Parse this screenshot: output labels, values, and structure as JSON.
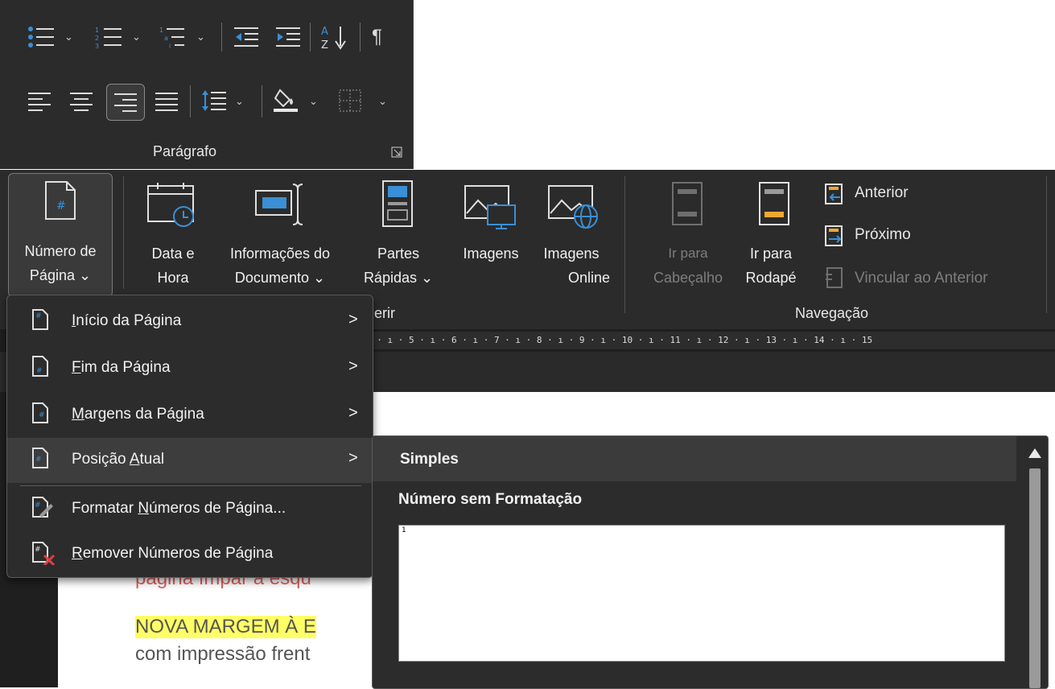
{
  "paragraph_group": {
    "label": "Parágrafo",
    "icons_row1": [
      "bullets-icon",
      "numbering-icon",
      "multilevel-list-icon",
      "decrease-indent-icon",
      "increase-indent-icon",
      "sort-icon",
      "pilcrow-icon"
    ],
    "icons_row2": [
      "align-left-icon",
      "align-center-icon",
      "align-right-icon",
      "justify-icon",
      "line-spacing-icon",
      "shading-icon",
      "borders-icon"
    ]
  },
  "ribbon": {
    "page_number": {
      "line1": "Número de",
      "line2": "Página ⌄"
    },
    "date_time": {
      "line1": "Data e",
      "line2": "Hora"
    },
    "doc_info": {
      "line1": "Informações do",
      "line2": "Documento ⌄"
    },
    "quick_parts": {
      "line1": "Partes",
      "line2": "Rápidas ⌄"
    },
    "images": {
      "line1": "Imagens",
      "line2": ""
    },
    "online_images": {
      "line1": "Imagens",
      "line2": "Online"
    },
    "group_insert_partial": "erir",
    "go_to_header": {
      "line1": "Ir para",
      "line2": "Cabeçalho"
    },
    "go_to_footer": {
      "line1": "Ir para",
      "line2": "Rodapé"
    },
    "previous": "Anterior",
    "next": "Próximo",
    "link_previous": "Vincular ao Anterior",
    "group_navigation": "Navegação"
  },
  "ruler": {
    "text": "4 · ı · 5 · ı · 6 · ı · 7 · ı · 8 · ı · 9 · ı · 10 · ı · 11 · ı · 12 · ı · 13 · ı · 14 · ı · 15"
  },
  "menu": {
    "items": [
      {
        "label_pre": "",
        "mnemonic": "I",
        "label_post": "nício da Página",
        "has_sub": true
      },
      {
        "label_pre": "",
        "mnemonic": "F",
        "label_post": "im da Página",
        "has_sub": true
      },
      {
        "label_pre": "",
        "mnemonic": "M",
        "label_post": "argens da Página",
        "has_sub": true
      },
      {
        "label_pre": "Posição ",
        "mnemonic": "A",
        "label_post": "tual",
        "has_sub": true
      },
      {
        "label_pre": "Formatar ",
        "mnemonic": "N",
        "label_post": "úmeros de Página...",
        "has_sub": false
      },
      {
        "label_pre": "",
        "mnemonic": "R",
        "label_post": "emover Números de Página",
        "has_sub": false
      }
    ],
    "arrow": ">"
  },
  "gallery": {
    "section": "Simples",
    "item_title": "Número sem Formatação",
    "preview_number": "1"
  },
  "document": {
    "line1": "página ímpar à esqu",
    "line2": "NOVA MARGEM À E",
    "line3": "com impressão frent"
  },
  "colors": {
    "ribbon_bg": "#2b2b2b",
    "accent_orange": "#f0a830",
    "accent_blue": "#3a8fd6",
    "highlight_yellow": "#ffff66",
    "doc_red": "#e06060"
  }
}
